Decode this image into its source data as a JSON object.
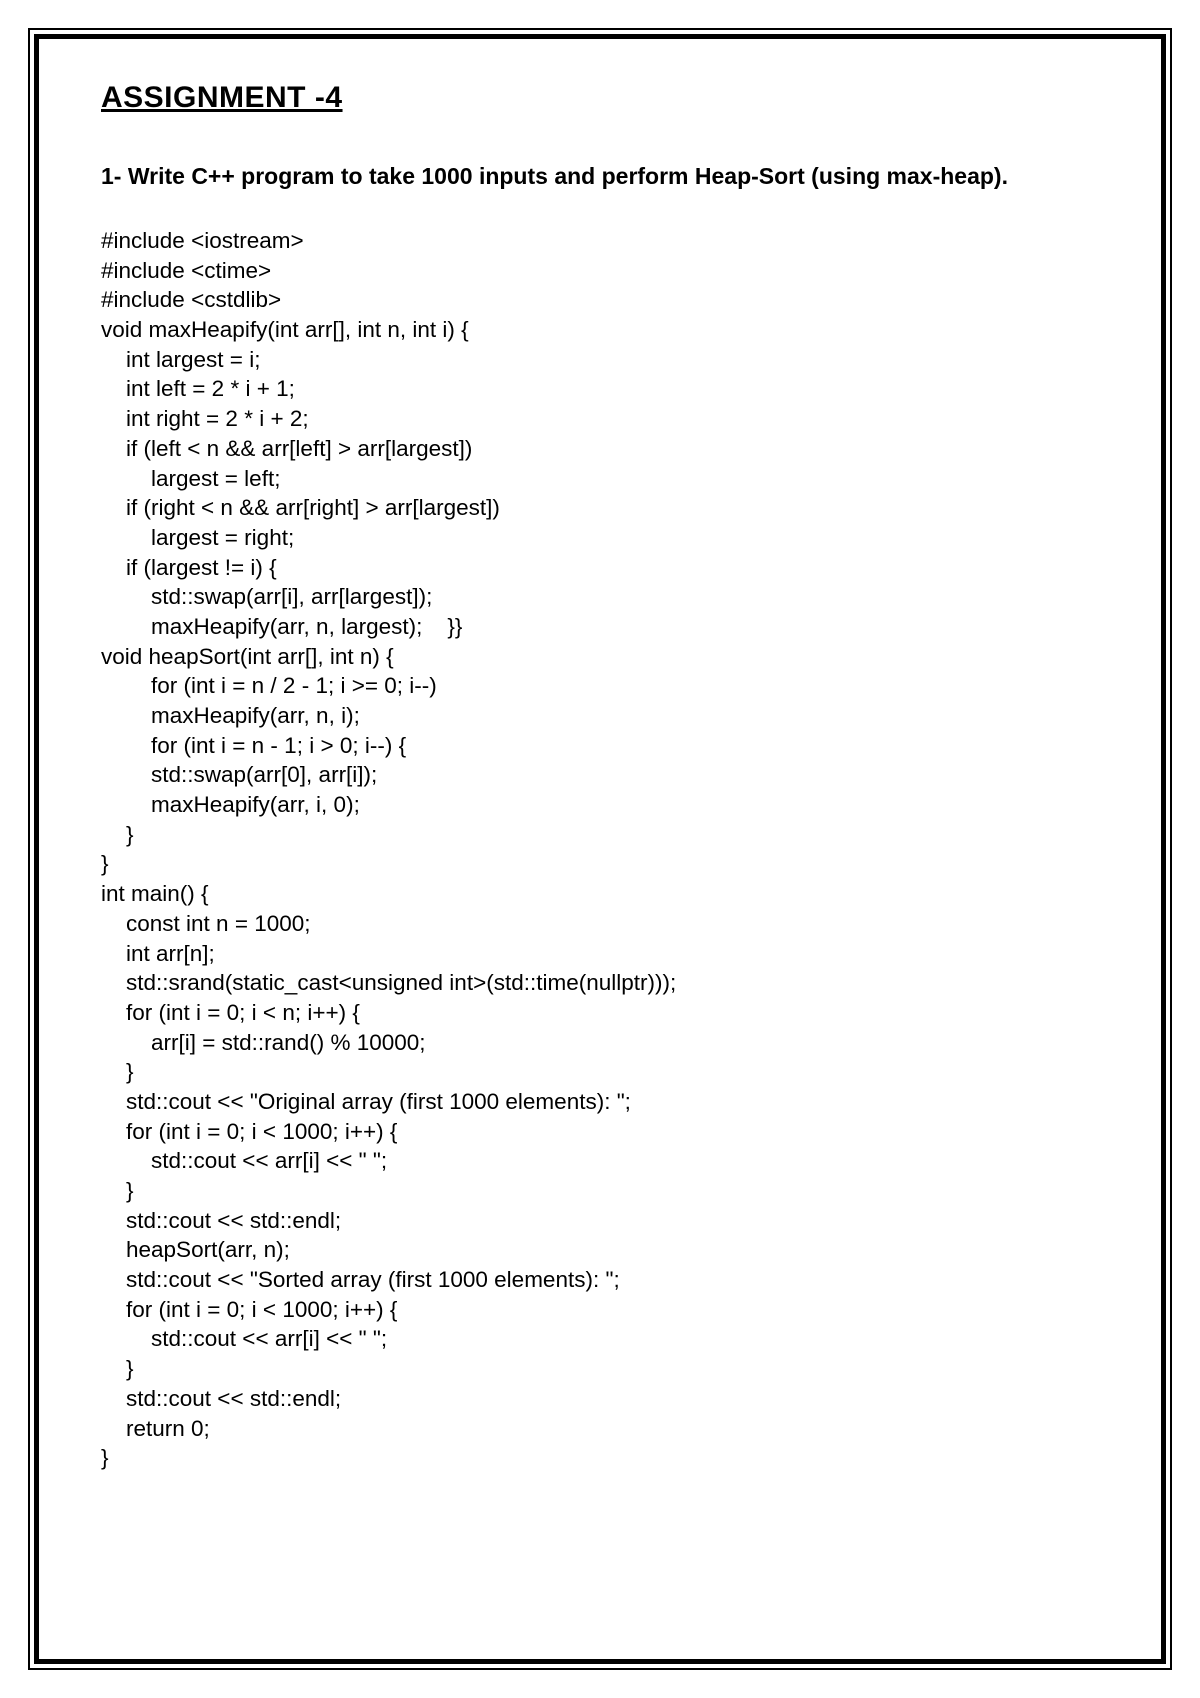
{
  "title": "ASSIGNMENT -4",
  "question": "1- Write C++ program to take 1000 inputs and perform Heap-Sort (using max-heap).",
  "code": "#include <iostream>\n#include <ctime>\n#include <cstdlib>\nvoid maxHeapify(int arr[], int n, int i) {\n    int largest = i;\n    int left = 2 * i + 1;\n    int right = 2 * i + 2;\n    if (left < n && arr[left] > arr[largest])\n        largest = left;\n    if (right < n && arr[right] > arr[largest])\n        largest = right;\n    if (largest != i) {\n        std::swap(arr[i], arr[largest]);\n        maxHeapify(arr, n, largest);    }}\nvoid heapSort(int arr[], int n) {\n        for (int i = n / 2 - 1; i >= 0; i--)\n        maxHeapify(arr, n, i);\n        for (int i = n - 1; i > 0; i--) {\n        std::swap(arr[0], arr[i]);\n        maxHeapify(arr, i, 0);\n    }\n}\nint main() {\n    const int n = 1000;\n    int arr[n];\n    std::srand(static_cast<unsigned int>(std::time(nullptr)));\n    for (int i = 0; i < n; i++) {\n        arr[i] = std::rand() % 10000;\n    }\n    std::cout << \"Original array (first 1000 elements): \";\n    for (int i = 0; i < 1000; i++) {\n        std::cout << arr[i] << \" \";\n    }\n    std::cout << std::endl;\n    heapSort(arr, n);\n    std::cout << \"Sorted array (first 1000 elements): \";\n    for (int i = 0; i < 1000; i++) {\n        std::cout << arr[i] << \" \";\n    }\n    std::cout << std::endl;\n    return 0;\n}"
}
